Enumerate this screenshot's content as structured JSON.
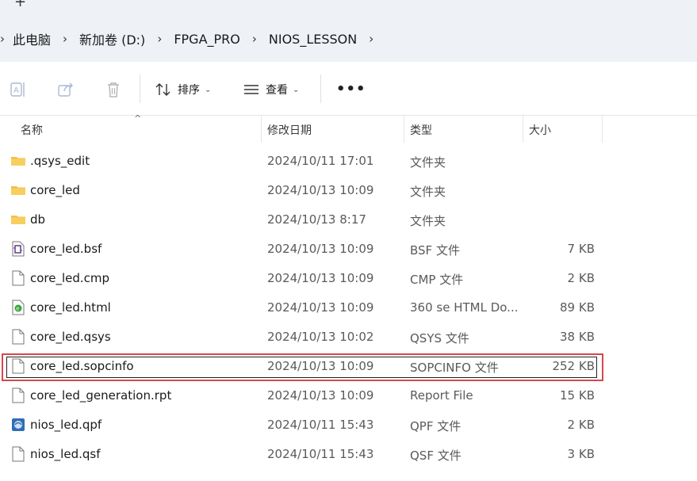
{
  "tab": {
    "new_tab_label": "+"
  },
  "breadcrumb": {
    "items": [
      "此电脑",
      "新加卷 (D:)",
      "FPGA_PRO",
      "NIOS_LESSON"
    ]
  },
  "toolbar": {
    "sort_label": "排序",
    "view_label": "查看",
    "more_label": "•••"
  },
  "columns": {
    "name": "名称",
    "date": "修改日期",
    "type": "类型",
    "size": "大小"
  },
  "colors": {
    "chrome_bg": "#eef1f6",
    "folder": "#f2c04a",
    "selection_border": "#d9464a",
    "html_icon": "#37a63b",
    "qpf_icon": "#2f6db5",
    "bsf_icon": "#5a2d82"
  },
  "files": [
    {
      "name": ".qsys_edit",
      "date": "2024/10/11 17:01",
      "type": "文件夹",
      "size": "",
      "icon": "folder-icon"
    },
    {
      "name": "core_led",
      "date": "2024/10/13 10:09",
      "type": "文件夹",
      "size": "",
      "icon": "folder-icon"
    },
    {
      "name": "db",
      "date": "2024/10/13 8:17",
      "type": "文件夹",
      "size": "",
      "icon": "folder-icon"
    },
    {
      "name": "core_led.bsf",
      "date": "2024/10/13 10:09",
      "type": "BSF 文件",
      "size": "7 KB",
      "icon": "bsf-file-icon"
    },
    {
      "name": "core_led.cmp",
      "date": "2024/10/13 10:09",
      "type": "CMP 文件",
      "size": "2 KB",
      "icon": "file-icon"
    },
    {
      "name": "core_led.html",
      "date": "2024/10/13 10:09",
      "type": "360 se HTML Do...",
      "size": "89 KB",
      "icon": "html-file-icon"
    },
    {
      "name": "core_led.qsys",
      "date": "2024/10/13 10:02",
      "type": "QSYS 文件",
      "size": "38 KB",
      "icon": "file-icon"
    },
    {
      "name": "core_led.sopcinfo",
      "date": "2024/10/13 10:09",
      "type": "SOPCINFO 文件",
      "size": "252 KB",
      "icon": "file-icon",
      "selected": true
    },
    {
      "name": "core_led_generation.rpt",
      "date": "2024/10/13 10:09",
      "type": "Report File",
      "size": "15 KB",
      "icon": "file-icon"
    },
    {
      "name": "nios_led.qpf",
      "date": "2024/10/11 15:43",
      "type": "QPF 文件",
      "size": "2 KB",
      "icon": "qpf-file-icon"
    },
    {
      "name": "nios_led.qsf",
      "date": "2024/10/11 15:43",
      "type": "QSF 文件",
      "size": "3 KB",
      "icon": "file-icon"
    }
  ]
}
